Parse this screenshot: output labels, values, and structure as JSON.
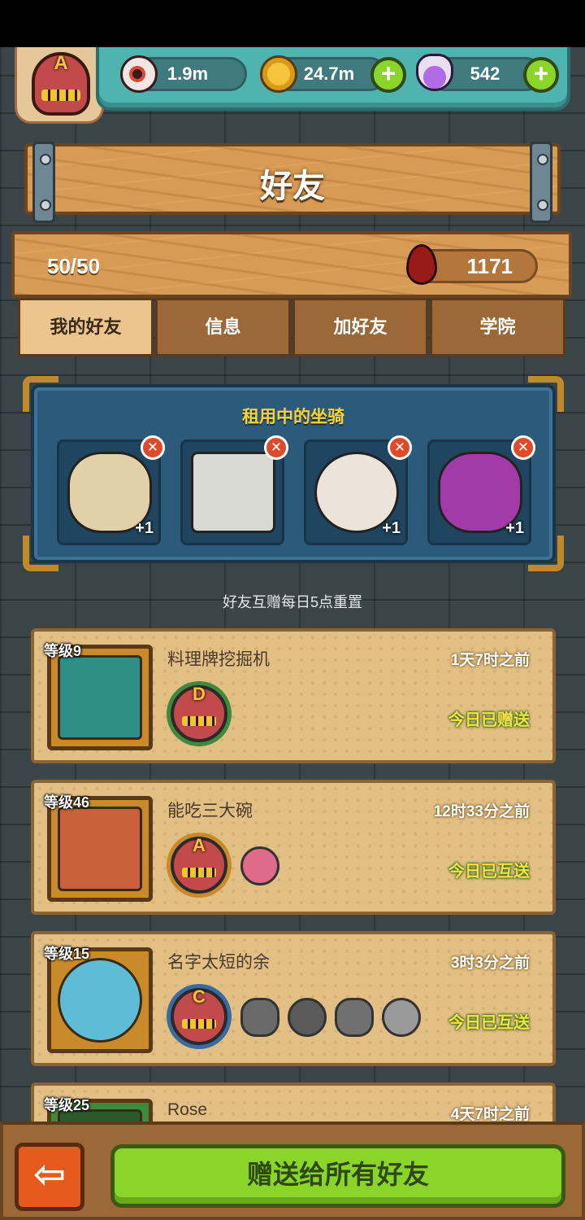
{
  "resources": {
    "eyeballs": "1.9m",
    "coins": "24.7m",
    "potions": "542",
    "plus_label": "+"
  },
  "rank": {
    "letter": "A"
  },
  "title": "好友",
  "friend_count": "50/50",
  "blood_points": "1171",
  "tabs": [
    {
      "label": "我的好友",
      "active": true
    },
    {
      "label": "信息",
      "active": false
    },
    {
      "label": "加好友",
      "active": false
    },
    {
      "label": "学院",
      "active": false
    }
  ],
  "mounts": {
    "title": "租用中的坐骑",
    "close_label": "✕",
    "items": [
      {
        "icon": "lion-dance-mount-icon",
        "bonus": "+1",
        "color": "#e2d1a8"
      },
      {
        "icon": "robot-machine-mount-icon",
        "bonus": "",
        "color": "#d7d9d2"
      },
      {
        "icon": "white-rabbit-mount-icon",
        "bonus": "+1",
        "color": "#ece4da"
      },
      {
        "icon": "purple-demon-mount-icon",
        "bonus": "+1",
        "color": "#a23aa8"
      }
    ]
  },
  "reset_note": "好友互赠每日5点重置",
  "friends": [
    {
      "level": "等级9",
      "name": "料理牌挖掘机",
      "time": "1天7时之前",
      "status": "今日已赠送",
      "rank": "D",
      "avatar_color": "#2f8f86",
      "rank_color": "#3f8a3a"
    },
    {
      "level": "等级46",
      "name": "能吃三大碗",
      "time": "12时33分之前",
      "status": "今日已互送",
      "rank": "A",
      "avatar_color": "#c8603a",
      "rank_color": "#c98a2a"
    },
    {
      "level": "等级15",
      "name": "名字太短的余",
      "time": "3时3分之前",
      "status": "今日已互送",
      "rank": "C",
      "avatar_color": "#5fbcd6",
      "rank_color": "#3a6aa0"
    },
    {
      "level": "等级25",
      "name": "Rose",
      "time": "4天7时之前",
      "status": "",
      "rank": "",
      "avatar_color": "#3f8a3a",
      "rank_color": "#c98a2a"
    }
  ],
  "bottom": {
    "back_label": "⇦",
    "gift_all_label": "赠送给所有好友"
  }
}
